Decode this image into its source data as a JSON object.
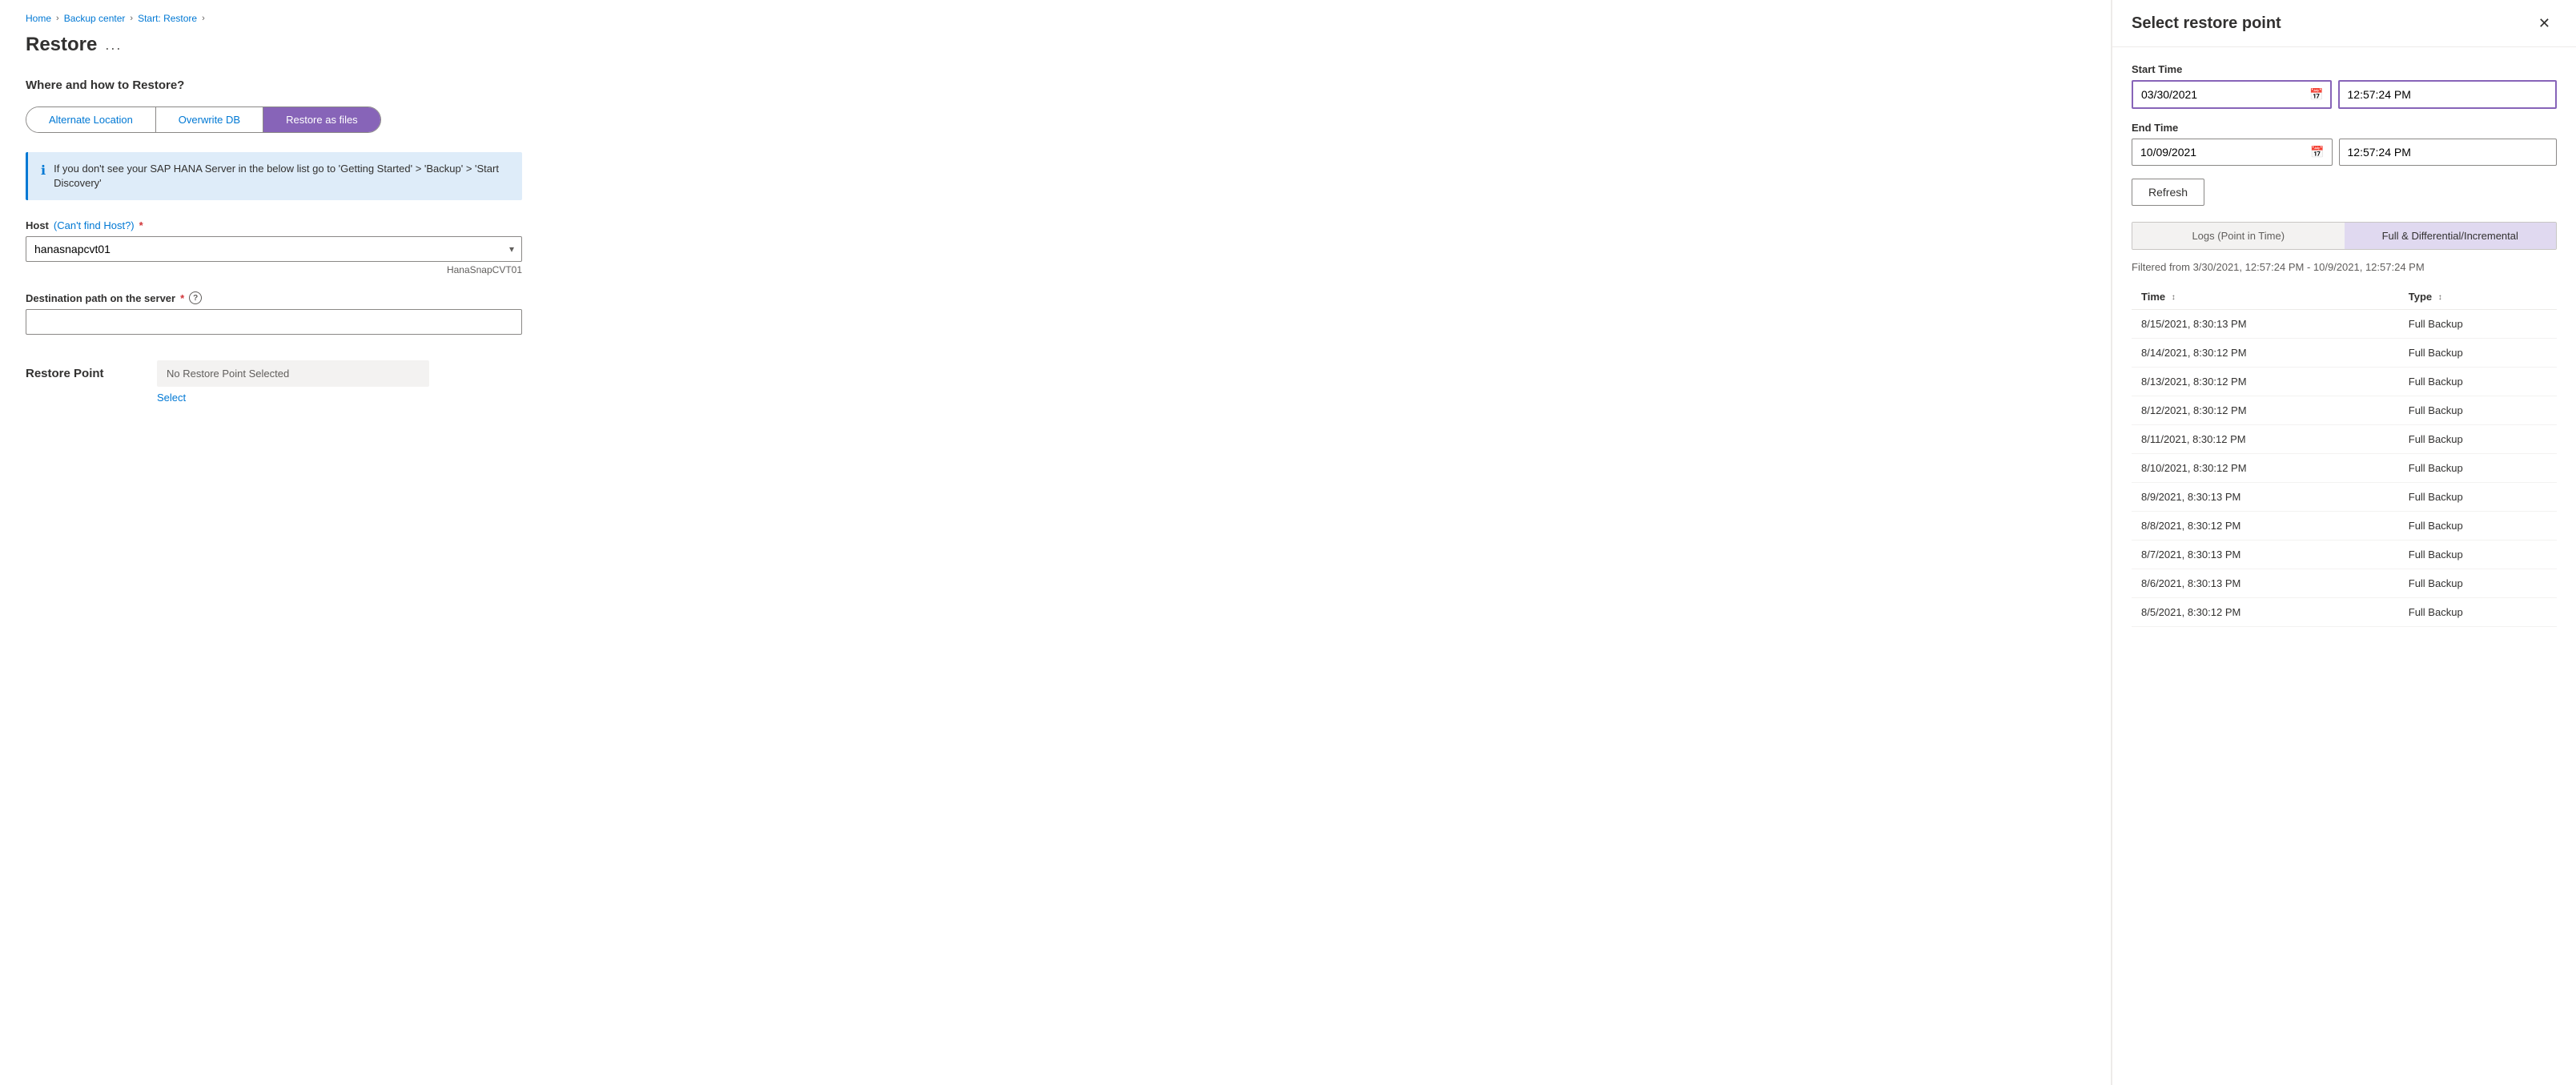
{
  "breadcrumb": {
    "home": "Home",
    "backup_center": "Backup center",
    "start_restore": "Start: Restore",
    "current": "Restore"
  },
  "page": {
    "title": "Restore",
    "ellipsis": "...",
    "section_label": "Where and how to Restore?"
  },
  "tabs": [
    {
      "id": "alternate",
      "label": "Alternate Location"
    },
    {
      "id": "overwrite",
      "label": "Overwrite DB"
    },
    {
      "id": "files",
      "label": "Restore as files"
    }
  ],
  "info_box": {
    "text": "If you don't see your SAP HANA Server in the below list go to 'Getting Started' > 'Backup' > 'Start Discovery'"
  },
  "host_field": {
    "label": "Host",
    "cant_find": "(Can't find Host?)",
    "value": "hanasnapcvt01",
    "helper": "HanaSnapCVT01"
  },
  "destination_field": {
    "label": "Destination path on the server",
    "placeholder": ""
  },
  "restore_point": {
    "label": "Restore Point",
    "no_value": "No Restore Point Selected",
    "select_label": "Select"
  },
  "right_panel": {
    "title": "Select restore point",
    "start_time_label": "Start Time",
    "start_date": "03/30/2021",
    "start_time": "12:57:24 PM",
    "end_time_label": "End Time",
    "end_date": "10/09/2021",
    "end_time": "12:57:24 PM",
    "refresh_label": "Refresh",
    "toggle_logs": "Logs (Point in Time)",
    "toggle_full": "Full & Differential/Incremental",
    "filter_text": "Filtered from 3/30/2021, 12:57:24 PM - 10/9/2021, 12:57:24 PM",
    "table_headers": [
      {
        "id": "time",
        "label": "Time"
      },
      {
        "id": "type",
        "label": "Type"
      }
    ],
    "table_rows": [
      {
        "time": "8/15/2021, 8:30:13 PM",
        "type": "Full Backup"
      },
      {
        "time": "8/14/2021, 8:30:12 PM",
        "type": "Full Backup"
      },
      {
        "time": "8/13/2021, 8:30:12 PM",
        "type": "Full Backup"
      },
      {
        "time": "8/12/2021, 8:30:12 PM",
        "type": "Full Backup"
      },
      {
        "time": "8/11/2021, 8:30:12 PM",
        "type": "Full Backup"
      },
      {
        "time": "8/10/2021, 8:30:12 PM",
        "type": "Full Backup"
      },
      {
        "time": "8/9/2021, 8:30:13 PM",
        "type": "Full Backup"
      },
      {
        "time": "8/8/2021, 8:30:12 PM",
        "type": "Full Backup"
      },
      {
        "time": "8/7/2021, 8:30:13 PM",
        "type": "Full Backup"
      },
      {
        "time": "8/6/2021, 8:30:13 PM",
        "type": "Full Backup"
      },
      {
        "time": "8/5/2021, 8:30:12 PM",
        "type": "Full Backup"
      }
    ]
  }
}
